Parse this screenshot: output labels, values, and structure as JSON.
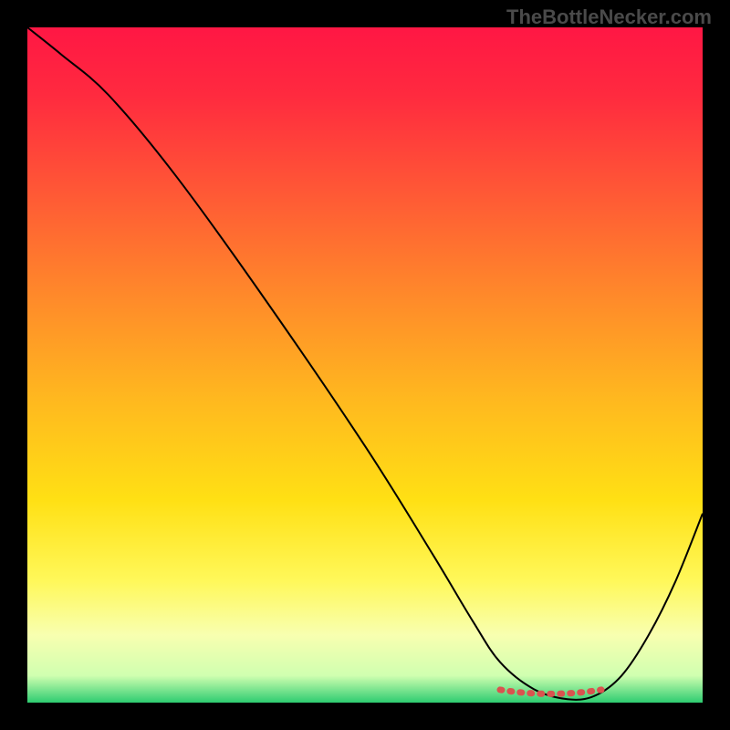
{
  "watermark": "TheBottleNecker.com",
  "chart_data": {
    "type": "line",
    "title": "",
    "xlabel": "",
    "ylabel": "",
    "xlim": [
      0,
      100
    ],
    "ylim": [
      0,
      100
    ],
    "grid": false,
    "background_gradient": {
      "stops": [
        {
          "offset": 0.0,
          "color": "#ff1744"
        },
        {
          "offset": 0.1,
          "color": "#ff2a3f"
        },
        {
          "offset": 0.25,
          "color": "#ff5a35"
        },
        {
          "offset": 0.4,
          "color": "#ff8a2a"
        },
        {
          "offset": 0.55,
          "color": "#ffb81f"
        },
        {
          "offset": 0.7,
          "color": "#ffe014"
        },
        {
          "offset": 0.82,
          "color": "#fff85a"
        },
        {
          "offset": 0.9,
          "color": "#f8ffb0"
        },
        {
          "offset": 0.96,
          "color": "#d0ffb0"
        },
        {
          "offset": 1.0,
          "color": "#2ecc71"
        }
      ]
    },
    "series": [
      {
        "name": "bottleneck-curve",
        "color": "#000000",
        "width": 2,
        "x": [
          0,
          5,
          12,
          22,
          35,
          50,
          60,
          66,
          70,
          75,
          80,
          84,
          88,
          92,
          96,
          100
        ],
        "y": [
          100,
          96,
          90,
          78,
          60,
          38,
          22,
          12,
          6,
          2,
          0.5,
          1,
          4,
          10,
          18,
          28
        ]
      }
    ],
    "flat_region_marker": {
      "color": "#d9534f",
      "style": "dotted",
      "x_start": 70,
      "x_end": 85,
      "y": 1.5
    }
  }
}
